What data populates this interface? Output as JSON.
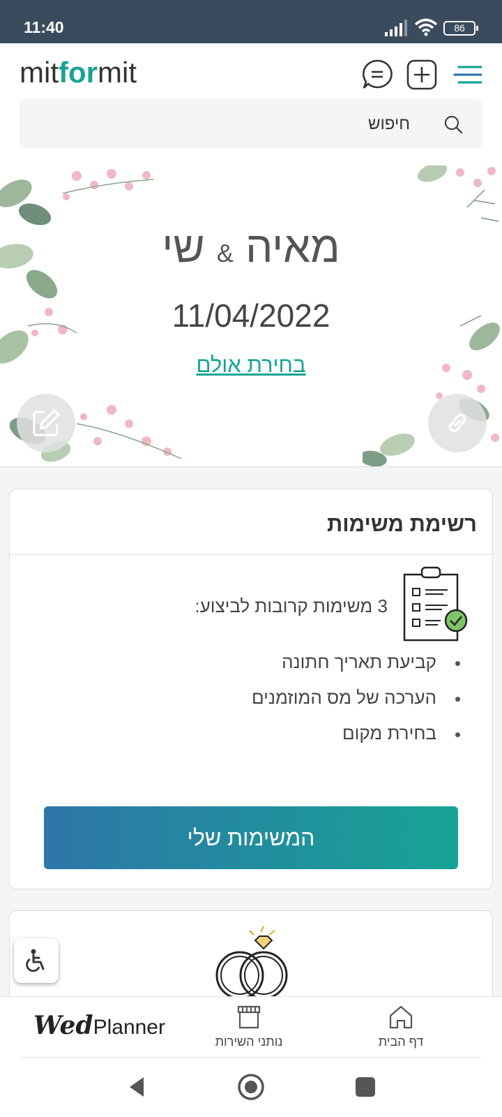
{
  "status_bar": {
    "time": "11:40",
    "battery": "86"
  },
  "header": {
    "logo": {
      "part1": "mit",
      "part2": "for",
      "part3": "mit"
    },
    "search_placeholder": "חיפוש"
  },
  "hero": {
    "name1": "מאיה",
    "ampersand": "&",
    "name2": "שי",
    "date": "11/04/2022",
    "venue_link": "בחירת אולם"
  },
  "task_card": {
    "title": "רשימת משימות",
    "upcoming": "3 משימות קרובות לביצוע:",
    "tasks": [
      "קביעת תאריך חתונה",
      "הערכה של מס המוזמנים",
      "בחירת מקום"
    ],
    "button": "המשימות שלי"
  },
  "bottom_nav": {
    "brand_script": "Wed",
    "brand_text": "Planner",
    "tabs": [
      {
        "label": "נותני השירות",
        "icon": "store-icon"
      },
      {
        "label": "דף הבית",
        "icon": "home-icon"
      }
    ]
  },
  "colors": {
    "accent": "#17a394",
    "gradient_start": "#2e76a8",
    "status_bar": "#3b4b5e"
  }
}
